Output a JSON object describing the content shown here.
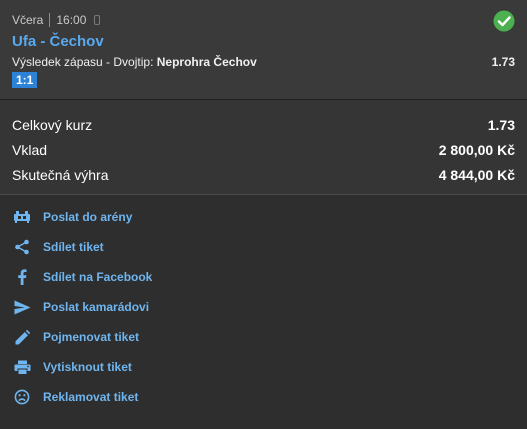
{
  "ticket": {
    "day": "Včera",
    "time": "16:00",
    "match": "Ufa - Čechov",
    "market": "Výsledek zápasu - Dvojtip:",
    "pick": "Neprohra Čechov",
    "odds": "1.73",
    "score": "1:1",
    "status_icon": "check-circle-icon",
    "status_color": "#4caf50"
  },
  "summary": {
    "total_odds_label": "Celkový kurz",
    "total_odds_value": "1.73",
    "stake_label": "Vklad",
    "stake_value": "2 800,00 Kč",
    "win_label": "Skutečná výhra",
    "win_value": "4 844,00 Kč"
  },
  "actions": [
    {
      "label": "Poslat do arény",
      "icon": "arena-icon"
    },
    {
      "label": "Sdílet tiket",
      "icon": "share-icon"
    },
    {
      "label": "Sdílet na Facebook",
      "icon": "facebook-icon"
    },
    {
      "label": "Poslat kamarádovi",
      "icon": "send-icon"
    },
    {
      "label": "Pojmenovat tiket",
      "icon": "pencil-icon"
    },
    {
      "label": "Vytisknout tiket",
      "icon": "printer-icon"
    },
    {
      "label": "Reklamovat tiket",
      "icon": "sad-face-icon"
    }
  ],
  "colors": {
    "accent": "#59a9ee",
    "link": "#6fb5ef",
    "badge": "#2c82d6",
    "background": "#2e2e2e"
  }
}
